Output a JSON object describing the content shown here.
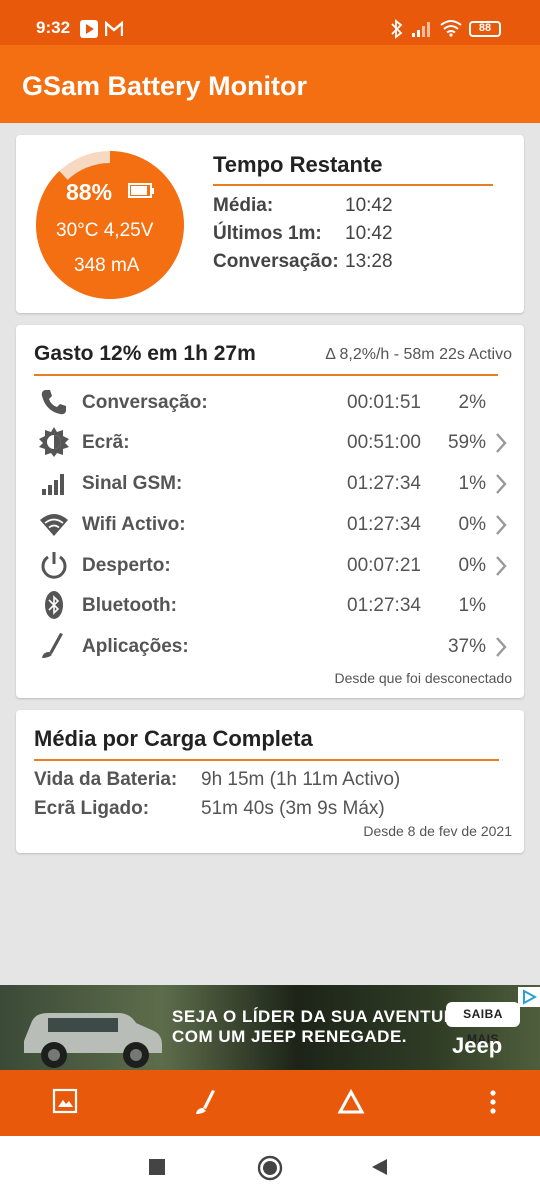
{
  "status_bar": {
    "time": "9:32",
    "battery": "88"
  },
  "app_title": "GSam Battery Monitor",
  "summary": {
    "gauge_percent_text": "88%",
    "gauge_level": 0.88,
    "temperature_voltage": "30°C  4,25V",
    "current": "348 mA",
    "remaining_title": "Tempo Restante",
    "rows": [
      {
        "label": "Média:",
        "value": "10:42"
      },
      {
        "label": "Últimos 1m:",
        "value": "10:42"
      },
      {
        "label": "Conversação:",
        "value": "13:28"
      }
    ]
  },
  "usage": {
    "title": "Gasto 12% em 1h 27m",
    "subtitle": "Δ 8,2%/h - 58m 22s Activo",
    "rows": [
      {
        "icon": "phone-icon",
        "label": "Conversação:",
        "duration": "00:01:51",
        "percent": "2%",
        "chevron": false
      },
      {
        "icon": "brightness-icon",
        "label": "Ecrã:",
        "duration": "00:51:00",
        "percent": "59%",
        "chevron": true
      },
      {
        "icon": "signal-icon",
        "label": "Sinal GSM:",
        "duration": "01:27:34",
        "percent": "1%",
        "chevron": true
      },
      {
        "icon": "wifi-icon",
        "label": "Wifi Activo:",
        "duration": "01:27:34",
        "percent": "0%",
        "chevron": true
      },
      {
        "icon": "power-icon",
        "label": "Desperto:",
        "duration": "00:07:21",
        "percent": "0%",
        "chevron": true
      },
      {
        "icon": "bluetooth-icon",
        "label": "Bluetooth:",
        "duration": "01:27:34",
        "percent": "1%",
        "chevron": false
      },
      {
        "icon": "apps-icon",
        "label": "Aplicações:",
        "duration": "",
        "percent": "37%",
        "chevron": true
      }
    ],
    "footer": "Desde que foi desconectado"
  },
  "full_charge": {
    "title": "Média por Carga Completa",
    "battery_life_label": "Vida da Bateria:",
    "battery_life_value": "9h 15m (1h 11m Activo)",
    "screen_on_label": "Ecrã Ligado:",
    "screen_on_value": "51m 40s (3m 9s Máx)",
    "footer": "Desde 8 de fev de 2021"
  },
  "ad": {
    "line1": "SEJA O LÍDER DA SUA AVENTURA",
    "line2": "COM UM JEEP RENEGADE.",
    "button": "SAIBA MAIS",
    "brand": "Jeep"
  },
  "colors": {
    "primary": "#f36f12",
    "status": "#e8590c",
    "accent_line": "#e77e22"
  }
}
